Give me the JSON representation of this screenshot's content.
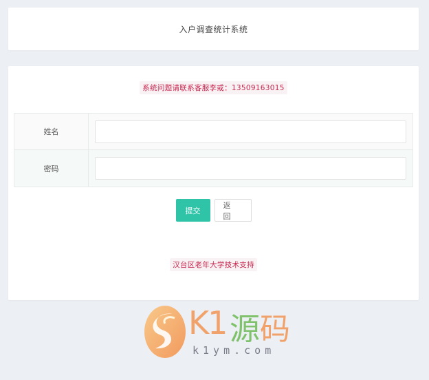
{
  "header": {
    "title": "入户调查统计系统"
  },
  "notice": {
    "text": "系统问题请联系客服李或：13509163015"
  },
  "form": {
    "rows": [
      {
        "label": "姓名",
        "value": "",
        "placeholder": ""
      },
      {
        "label": "密码",
        "value": "",
        "placeholder": ""
      }
    ]
  },
  "buttons": {
    "submit_label": "提交",
    "back_label": "返 回"
  },
  "footer": {
    "support_text": "汉台区老年大学技术支持"
  },
  "watermark": {
    "brand_k1": "K1",
    "brand_yuan": "源",
    "brand_ma": "码",
    "domain": "k1ym.com"
  },
  "colors": {
    "accent": "#2fc4a8",
    "notice_text": "#c7254e",
    "notice_bg": "#f9f2f4",
    "page_bg": "#eceff3"
  }
}
